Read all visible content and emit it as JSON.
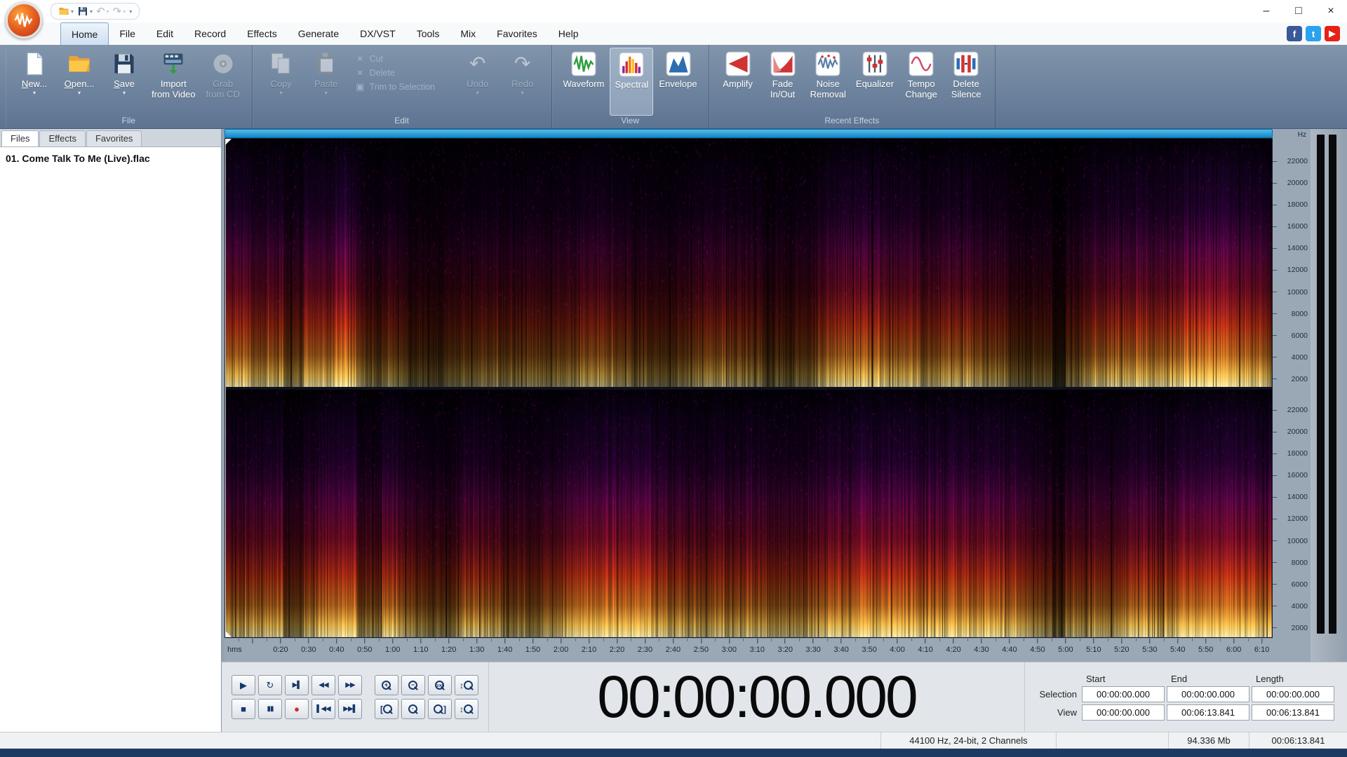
{
  "titlebar": {
    "qat": [
      {
        "name": "qat-open-button",
        "icon": "folder",
        "caret": true
      },
      {
        "name": "qat-save-button",
        "icon": "save",
        "caret": true
      },
      {
        "name": "qat-undo-button",
        "icon": "undo",
        "caret": true,
        "disabled": true
      },
      {
        "name": "qat-redo-button",
        "icon": "redo",
        "caret": true,
        "disabled": true
      },
      {
        "name": "qat-customize-button",
        "icon": "caret"
      }
    ]
  },
  "window": {
    "buttons": [
      {
        "name": "minimize",
        "glyph": "–"
      },
      {
        "name": "maximize",
        "glyph": "□"
      },
      {
        "name": "close",
        "glyph": "×"
      }
    ]
  },
  "menu": {
    "tabs": [
      {
        "label": "Home",
        "active": true
      },
      {
        "label": "File"
      },
      {
        "label": "Edit"
      },
      {
        "label": "Record"
      },
      {
        "label": "Effects"
      },
      {
        "label": "Generate"
      },
      {
        "label": "DX/VST"
      },
      {
        "label": "Tools"
      },
      {
        "label": "Mix"
      },
      {
        "label": "Favorites"
      },
      {
        "label": "Help"
      }
    ]
  },
  "social": [
    {
      "name": "facebook",
      "glyph": "f",
      "color": "#3b5998"
    },
    {
      "name": "twitter",
      "glyph": "t",
      "color": "#2aa3ef"
    },
    {
      "name": "youtube",
      "glyph": "▶",
      "color": "#e62117"
    }
  ],
  "ribbon": {
    "groups": [
      {
        "label": "File",
        "buttons": [
          {
            "label": "New...",
            "icon": "new-document-icon",
            "dropdown": true,
            "underline_first": true
          },
          {
            "label": "Open...",
            "icon": "open-folder-icon",
            "dropdown": true,
            "underline_first": true
          },
          {
            "label": "Save",
            "icon": "save-icon",
            "dropdown": true,
            "underline_first": true
          },
          {
            "label": "Import\nfrom Video",
            "icon": "import-video-icon"
          },
          {
            "label": "Grab\nfrom CD",
            "icon": "cd-icon",
            "disabled": true
          }
        ]
      },
      {
        "label": "Edit",
        "buttons": [
          {
            "label": "Copy",
            "icon": "copy-icon",
            "dropdown": true,
            "disabled": true
          },
          {
            "label": "Paste",
            "icon": "paste-icon",
            "dropdown": true,
            "disabled": true
          },
          {
            "stack": [
              {
                "label": "Cut",
                "icon": "cut-icon",
                "disabled": true
              },
              {
                "label": "Delete",
                "icon": "delete-icon",
                "disabled": true
              },
              {
                "label": "Trim to Selection",
                "icon": "trim-icon",
                "disabled": true
              }
            ]
          },
          {
            "label": "Undo",
            "icon": "undo-icon",
            "dropdown": true,
            "disabled": true
          },
          {
            "label": "Redo",
            "icon": "redo-icon",
            "dropdown": true,
            "disabled": true
          }
        ]
      },
      {
        "label": "View",
        "buttons": [
          {
            "label": "Waveform",
            "icon": "waveform-icon"
          },
          {
            "label": "Spectral",
            "icon": "spectral-icon",
            "active": true
          },
          {
            "label": "Envelope",
            "icon": "envelope-icon"
          }
        ]
      },
      {
        "label": "Recent Effects",
        "buttons": [
          {
            "label": "Amplify",
            "icon": "amplify-icon"
          },
          {
            "label": "Fade\nIn/Out",
            "icon": "fade-icon"
          },
          {
            "label": "Noise\nRemoval",
            "icon": "noise-removal-icon"
          },
          {
            "label": "Equalizer",
            "icon": "equalizer-icon"
          },
          {
            "label": "Tempo\nChange",
            "icon": "tempo-icon"
          },
          {
            "label": "Delete\nSilence",
            "icon": "delete-silence-icon"
          }
        ]
      }
    ]
  },
  "sidebar": {
    "tabs": [
      {
        "label": "Files",
        "active": true
      },
      {
        "label": "Effects"
      },
      {
        "label": "Favorites"
      }
    ],
    "files": [
      "01. Come Talk To Me (Live).flac"
    ]
  },
  "editor": {
    "freq_unit": "Hz",
    "time_unit": "hms",
    "freq_labels": [
      "22000",
      "20000",
      "18000",
      "16000",
      "14000",
      "12000",
      "10000",
      "8000",
      "6000",
      "4000",
      "2000"
    ],
    "time_labels": [
      "0:20",
      "0:30",
      "0:40",
      "0:50",
      "1:00",
      "1:10",
      "1:20",
      "1:30",
      "1:40",
      "1:50",
      "2:00",
      "2:10",
      "2:20",
      "2:30",
      "2:40",
      "2:50",
      "3:00",
      "3:10",
      "3:20",
      "3:30",
      "3:40",
      "3:50",
      "4:00",
      "4:10",
      "4:20",
      "4:30",
      "4:40",
      "4:50",
      "5:00",
      "5:10",
      "5:20",
      "5:30",
      "5:40",
      "5:50",
      "6:00",
      "6:10"
    ]
  },
  "transport": {
    "rows": [
      [
        {
          "name": "play-button",
          "glyph": "▶"
        },
        {
          "name": "loop-play-button",
          "glyph": "↻"
        },
        {
          "name": "play-next-button",
          "glyph": "▶▌",
          "small": true
        },
        {
          "name": "rewind-button",
          "glyph": "◀◀",
          "small": true
        },
        {
          "name": "fast-forward-button",
          "glyph": "▶▶",
          "small": true
        },
        {
          "name": "zoom-in-button",
          "kind": "mag",
          "mod": "+"
        },
        {
          "name": "zoom-out-button",
          "kind": "mag",
          "mod": "−"
        },
        {
          "name": "zoom-100-button",
          "kind": "mag",
          "mod": "100"
        },
        {
          "name": "zoom-vertical-in-button",
          "kind": "mag",
          "pre": "↕"
        }
      ],
      [
        {
          "name": "stop-button",
          "glyph": "■"
        },
        {
          "name": "pause-button",
          "glyph": "▮▮",
          "small": true
        },
        {
          "name": "record-button",
          "glyph": "●"
        },
        {
          "name": "go-to-start-button",
          "glyph": "▌◀◀",
          "small": true
        },
        {
          "name": "go-to-end-button",
          "glyph": "▶▶▌",
          "small": true
        },
        {
          "name": "zoom-selection-start-button",
          "kind": "mag",
          "pre": "["
        },
        {
          "name": "zoom-selection-button",
          "kind": "mag",
          "mod": "·"
        },
        {
          "name": "zoom-selection-end-button",
          "kind": "mag",
          "suf": "]"
        },
        {
          "name": "zoom-vertical-out-button",
          "kind": "mag",
          "pre": "↕"
        }
      ]
    ]
  },
  "time_display": "00:00:00.000",
  "selection_panel": {
    "col_headers": [
      "Start",
      "End",
      "Length"
    ],
    "rows": [
      {
        "label": "Selection",
        "values": [
          "00:00:00.000",
          "00:00:00.000",
          "00:00:00.000"
        ]
      },
      {
        "label": "View",
        "values": [
          "00:00:00.000",
          "00:06:13.841",
          "00:06:13.841"
        ]
      }
    ]
  },
  "statusbar": {
    "format": "44100 Hz, 24-bit, 2 Channels",
    "file_size": "94.336 Mb",
    "length": "00:06:13.841"
  },
  "colors": {
    "position_bar": "#1e8fd0",
    "record": "#d22828",
    "bottom_strip": "#1d3a63"
  }
}
